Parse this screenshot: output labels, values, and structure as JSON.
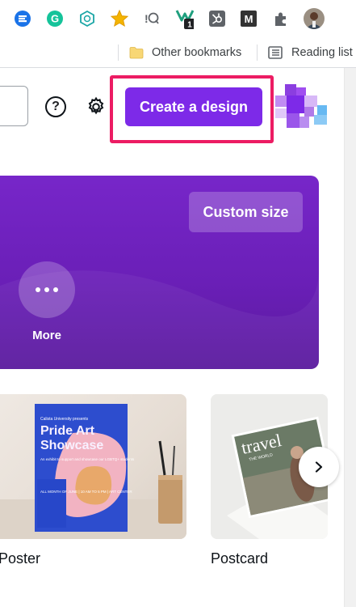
{
  "bookmarks": {
    "other_bookmarks": "Other bookmarks",
    "reading_list": "Reading list"
  },
  "extensions": {
    "badge_count": "1",
    "icons": [
      "ext-blue-e-icon",
      "grammarly-icon",
      "ext-hex-icon",
      "star-icon",
      "ext-q-icon",
      "ext-w-icon",
      "ext-hubspot-icon",
      "medium-m-icon",
      "puzzle-icon",
      "profile-avatar"
    ]
  },
  "header": {
    "help_label": "?",
    "create_button": "Create a design"
  },
  "hero": {
    "custom_size": "Custom size",
    "more_label": "More"
  },
  "templates": {
    "poster": {
      "label": "Poster",
      "org": "Calista University presents",
      "title_1": "Pride Art",
      "title_2": "Showcase",
      "desc": "An exhibit to support and showcase our LGBTQ+ students",
      "date": "ALL MONTH OF JUNE | 10 AM TO 5 PM | ART CENTER"
    },
    "postcard": {
      "label": "Postcard",
      "card_title": "travel",
      "card_sub": "THE WORLD"
    }
  },
  "colors": {
    "canva_purple": "#7d2ae8",
    "highlight_pink": "#ec1c63",
    "hero_purple": "#7726c9"
  }
}
